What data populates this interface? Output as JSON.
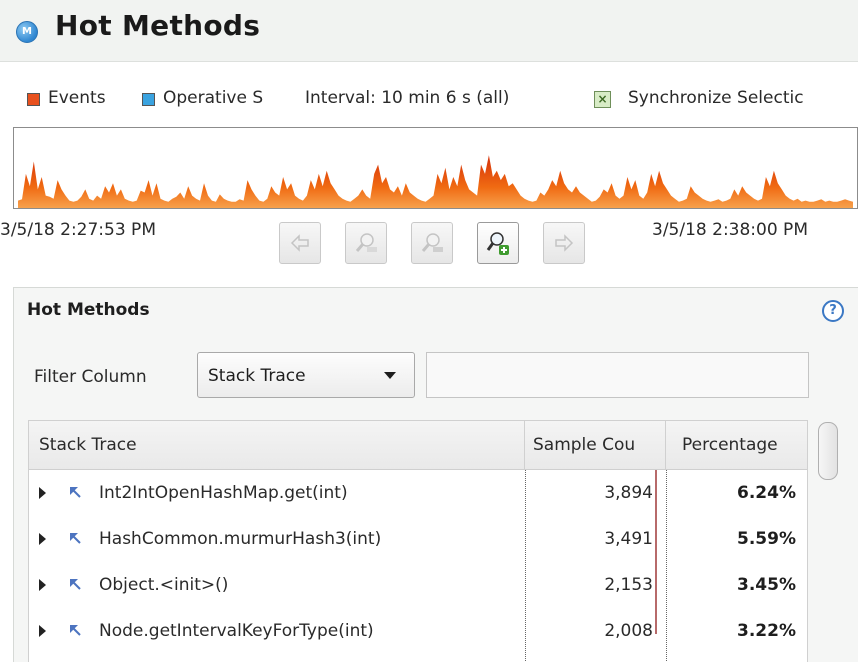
{
  "header": {
    "icon": "M",
    "title": "Hot Methods"
  },
  "legend": {
    "events_label": "Events",
    "events_color": "#e8511e",
    "operative_label": "Operative S",
    "operative_color": "#3aa3e0",
    "interval_label": "Interval: 10 min 6 s (all)",
    "sync_label": "Synchronize Selectic",
    "sync_icon": "checkbox-x-icon"
  },
  "timeline": {
    "start": "3/5/18 2:27:53 PM",
    "end": "3/5/18 2:38:00 PM",
    "fill_color": "#f06a12",
    "activity": [
      0.12,
      0.14,
      0.55,
      0.35,
      0.75,
      0.3,
      0.5,
      0.2,
      0.18,
      0.15,
      0.45,
      0.3,
      0.2,
      0.12,
      0.1,
      0.12,
      0.18,
      0.3,
      0.15,
      0.12,
      0.2,
      0.15,
      0.35,
      0.25,
      0.4,
      0.2,
      0.3,
      0.15,
      0.12,
      0.1,
      0.12,
      0.28,
      0.25,
      0.45,
      0.2,
      0.4,
      0.15,
      0.12,
      0.1,
      0.15,
      0.18,
      0.25,
      0.15,
      0.35,
      0.2,
      0.15,
      0.12,
      0.4,
      0.2,
      0.12,
      0.1,
      0.22,
      0.15,
      0.12,
      0.1,
      0.1,
      0.14,
      0.12,
      0.45,
      0.3,
      0.2,
      0.12,
      0.1,
      0.15,
      0.35,
      0.25,
      0.2,
      0.5,
      0.3,
      0.4,
      0.2,
      0.15,
      0.12,
      0.2,
      0.45,
      0.3,
      0.55,
      0.35,
      0.6,
      0.4,
      0.3,
      0.2,
      0.15,
      0.12,
      0.1,
      0.15,
      0.2,
      0.3,
      0.2,
      0.15,
      0.55,
      0.7,
      0.4,
      0.5,
      0.3,
      0.25,
      0.35,
      0.2,
      0.4,
      0.25,
      0.2,
      0.15,
      0.12,
      0.1,
      0.15,
      0.2,
      0.55,
      0.4,
      0.65,
      0.3,
      0.5,
      0.35,
      0.7,
      0.45,
      0.3,
      0.25,
      0.2,
      0.7,
      0.55,
      0.85,
      0.5,
      0.6,
      0.45,
      0.55,
      0.35,
      0.4,
      0.3,
      0.2,
      0.15,
      0.12,
      0.1,
      0.12,
      0.25,
      0.2,
      0.3,
      0.45,
      0.35,
      0.6,
      0.4,
      0.3,
      0.25,
      0.35,
      0.25,
      0.2,
      0.15,
      0.1,
      0.12,
      0.18,
      0.3,
      0.25,
      0.4,
      0.2,
      0.15,
      0.2,
      0.5,
      0.3,
      0.45,
      0.2,
      0.15,
      0.25,
      0.55,
      0.35,
      0.6,
      0.4,
      0.3,
      0.2,
      0.15,
      0.1,
      0.12,
      0.15,
      0.35,
      0.25,
      0.2,
      0.15,
      0.12,
      0.1,
      0.12,
      0.14,
      0.1,
      0.12,
      0.15,
      0.3,
      0.2,
      0.35,
      0.25,
      0.2,
      0.15,
      0.12,
      0.15,
      0.5,
      0.35,
      0.6,
      0.4,
      0.3,
      0.2,
      0.15,
      0.12,
      0.15,
      0.1,
      0.12,
      0.1,
      0.1,
      0.12,
      0.14,
      0.1,
      0.12,
      0.1,
      0.1,
      0.12,
      0.14,
      0.12,
      0.1
    ]
  },
  "nav_buttons": [
    {
      "name": "scroll-left-button",
      "icon": "arrow-left-icon",
      "enabled": false
    },
    {
      "name": "zoom-out-button",
      "icon": "zoom-out-icon",
      "enabled": false
    },
    {
      "name": "zoom-reset-button",
      "icon": "zoom-reset-icon",
      "enabled": false
    },
    {
      "name": "zoom-in-button",
      "icon": "zoom-in-icon",
      "enabled": true
    },
    {
      "name": "scroll-right-button",
      "icon": "arrow-right-icon",
      "enabled": false
    }
  ],
  "panel": {
    "title": "Hot Methods",
    "help_icon": "?",
    "filter_label": "Filter Column",
    "filter_value": "Stack Trace",
    "filter_text": ""
  },
  "table": {
    "columns": [
      "Stack Trace",
      "Sample Cou",
      "Percentage"
    ],
    "rows": [
      {
        "method": "Int2IntOpenHashMap.get(int)",
        "samples": "3,894",
        "percentage": "6.24%"
      },
      {
        "method": "HashCommon.murmurHash3(int)",
        "samples": "3,491",
        "percentage": "5.59%"
      },
      {
        "method": "Object.<init>()",
        "samples": "2,153",
        "percentage": "3.45%"
      },
      {
        "method": "Node.getIntervalKeyForType(int)",
        "samples": "2,008",
        "percentage": "3.22%"
      }
    ]
  }
}
